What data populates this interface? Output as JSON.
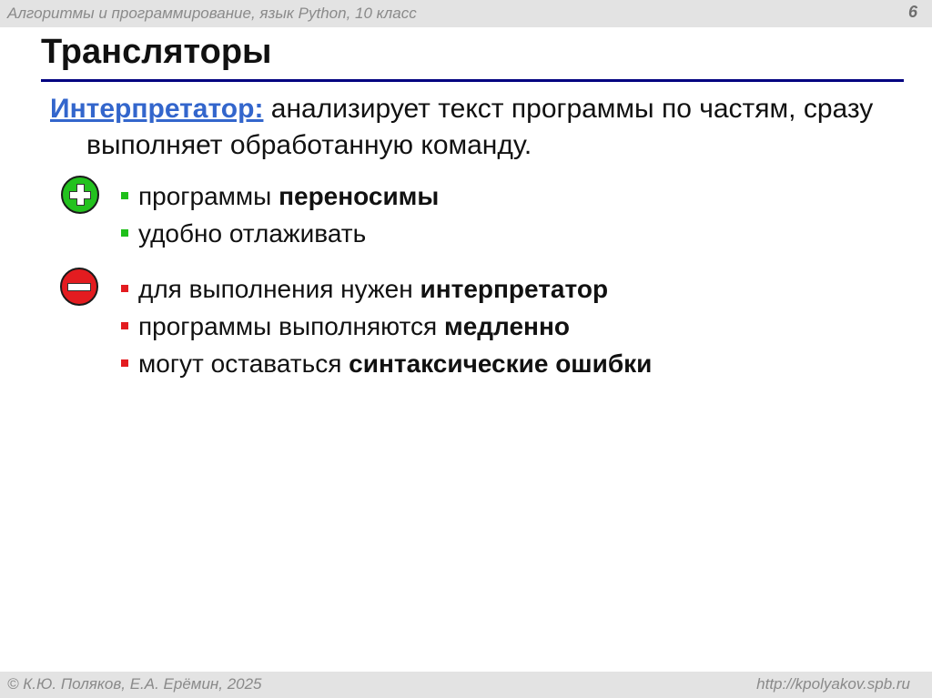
{
  "header": {
    "course": "Алгоритмы и программирование, язык Python, 10 класс",
    "page_number": "6"
  },
  "slide": {
    "title": "Трансляторы",
    "intro": {
      "term": "Интерпретатор:",
      "text": " анализирует текст программы по частям, сразу выполняет обработанную команду."
    },
    "pros_icon": "plus-icon",
    "cons_icon": "minus-icon",
    "pros": [
      {
        "text": "программы ",
        "bold": "переносимы"
      },
      {
        "text": "удобно отлаживать",
        "bold": ""
      }
    ],
    "cons": [
      {
        "text": "для выполнения нужен ",
        "bold": "интерпретатор"
      },
      {
        "text": "программы выполняются ",
        "bold": "медленно"
      },
      {
        "text": "могут оставаться ",
        "bold": "синтаксические ошибки"
      }
    ]
  },
  "footer": {
    "authors": "© К.Ю. Поляков, Е.А. Ерёмин, 2025",
    "url": "http://kpolyakov.spb.ru"
  },
  "colors": {
    "accent_blue": "#3366cc",
    "rule_navy": "#000080",
    "pro_green": "#1fbf1a",
    "con_red": "#e31c20"
  }
}
